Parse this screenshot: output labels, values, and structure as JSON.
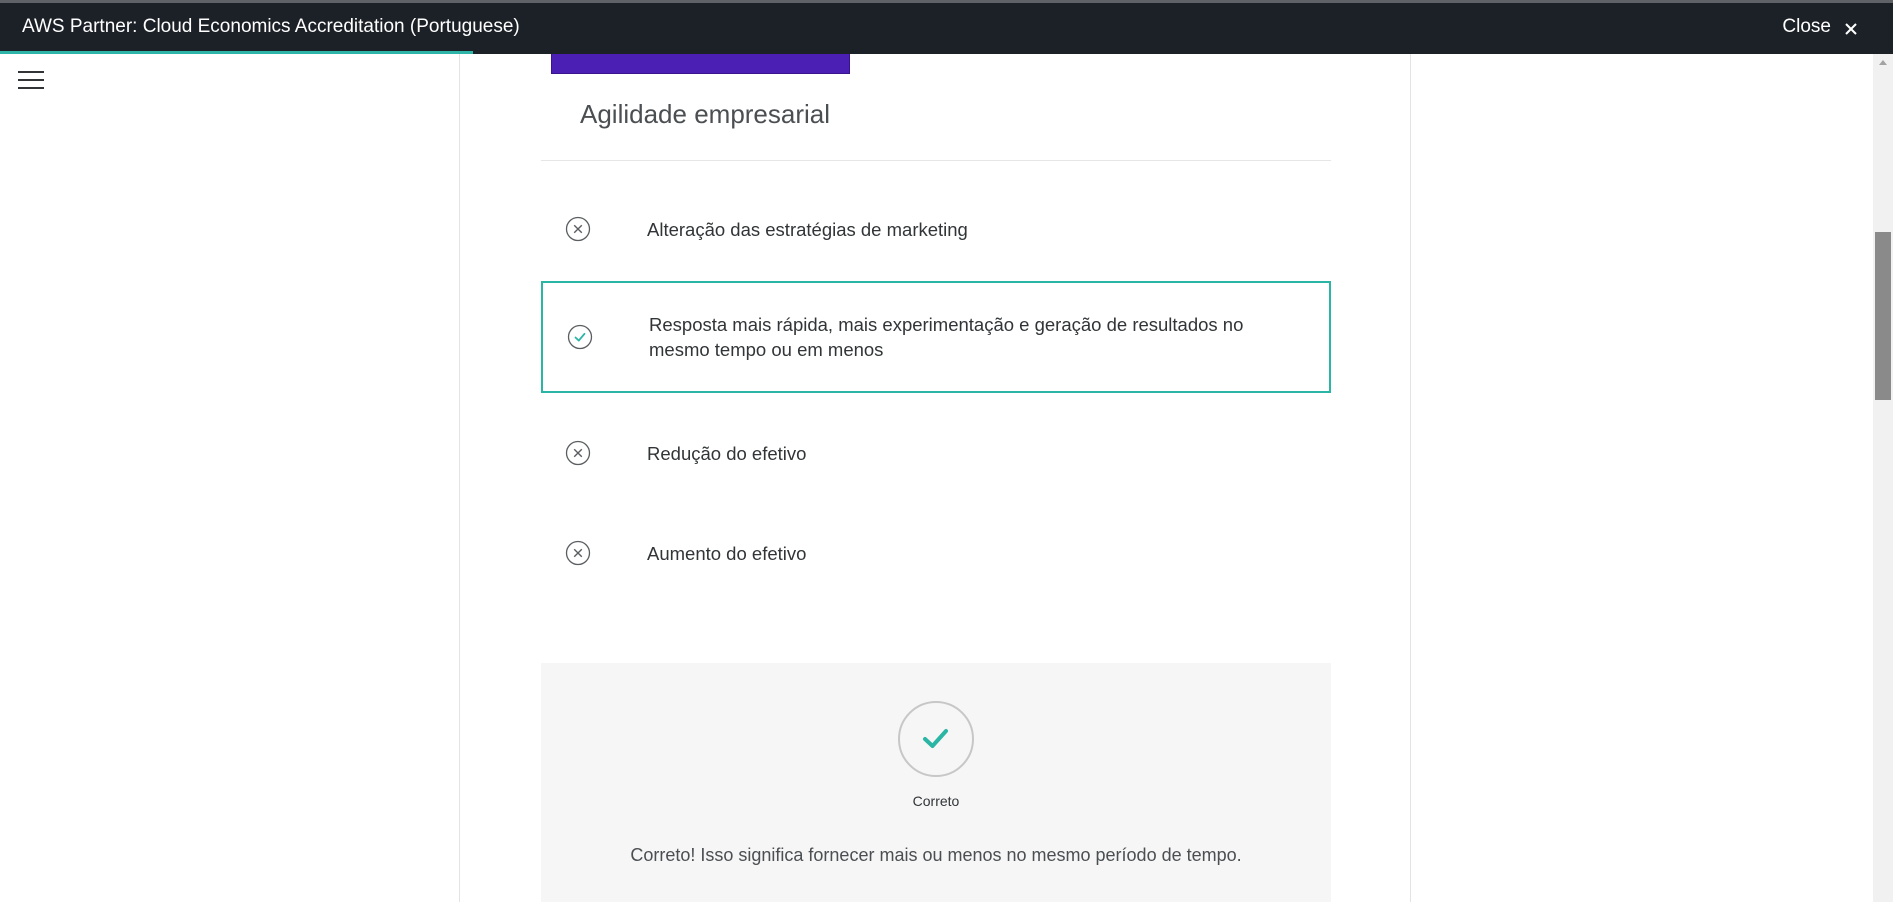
{
  "header": {
    "title": "AWS Partner: Cloud Economics Accreditation (Portuguese)",
    "close_label": "Close"
  },
  "progress": {
    "fraction": 0.25
  },
  "question": {
    "text": "Agilidade empresarial",
    "options": [
      {
        "label": "Alteração das estratégias de marketing",
        "state": "incorrect"
      },
      {
        "label": "Resposta mais rápida, mais experimentação e geração de resultados no mesmo tempo ou em menos",
        "state": "correct"
      },
      {
        "label": "Redução do efetivo",
        "state": "incorrect"
      },
      {
        "label": "Aumento do efetivo",
        "state": "incorrect"
      }
    ]
  },
  "feedback": {
    "status": "Correto",
    "message": "Correto! Isso significa fornecer mais ou menos no mesmo período de tempo."
  },
  "icons": {
    "menu": "hamburger-menu-icon",
    "close": "close-icon",
    "incorrect": "x-circle-icon",
    "correct": "check-circle-icon",
    "feedback": "check-icon"
  },
  "colors": {
    "topbar": "#1c2027",
    "accent": "#2fb5a8",
    "header_block": "#4b1fb3",
    "feedback_bg": "#f6f6f6"
  }
}
